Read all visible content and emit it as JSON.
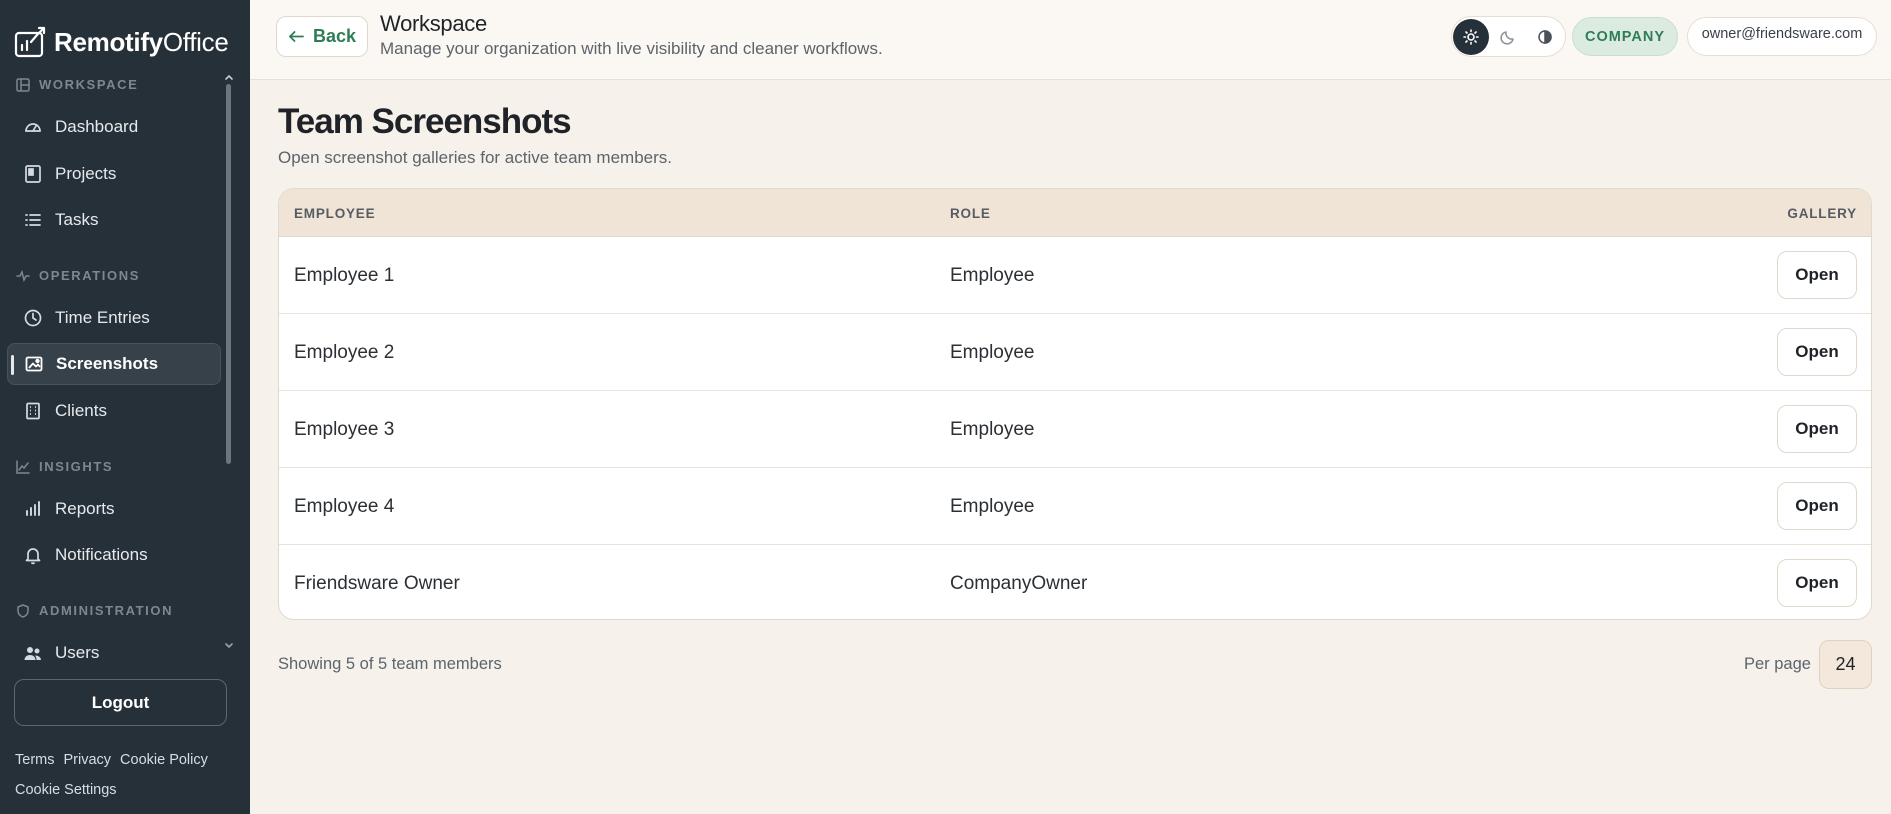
{
  "brand": {
    "name_bold": "Remotify",
    "name_light": "Office"
  },
  "sidebar": {
    "sections": [
      {
        "label": "WORKSPACE",
        "icon": "layout-icon"
      },
      {
        "label": "OPERATIONS",
        "icon": "activity-icon"
      },
      {
        "label": "INSIGHTS",
        "icon": "trend-icon"
      },
      {
        "label": "ADMINISTRATION",
        "icon": "shield-icon"
      }
    ],
    "items": [
      {
        "label": "Dashboard",
        "icon": "gauge-icon"
      },
      {
        "label": "Projects",
        "icon": "folder-icon"
      },
      {
        "label": "Tasks",
        "icon": "list-icon"
      },
      {
        "label": "Time Entries",
        "icon": "clock-icon"
      },
      {
        "label": "Screenshots",
        "icon": "image-icon",
        "active": true
      },
      {
        "label": "Clients",
        "icon": "building-icon"
      },
      {
        "label": "Reports",
        "icon": "bar-chart-icon"
      },
      {
        "label": "Notifications",
        "icon": "bell-icon"
      },
      {
        "label": "Users",
        "icon": "users-icon"
      }
    ],
    "logout_label": "Logout",
    "footer_links": [
      "Terms",
      "Privacy",
      "Cookie Policy",
      "Cookie Settings"
    ]
  },
  "header": {
    "back_label": "Back",
    "title": "Workspace",
    "subtitle": "Manage your organization with live visibility and cleaner workflows.",
    "theme_options": [
      "light",
      "dark",
      "contrast"
    ],
    "theme_selected": "light",
    "role_badge": "COMPANY",
    "user_email": "owner@friendsware.com"
  },
  "main": {
    "title": "Team Screenshots",
    "subtitle": "Open screenshot galleries for active team members.",
    "table": {
      "columns": [
        "EMPLOYEE",
        "ROLE",
        "GALLERY"
      ],
      "rows": [
        {
          "employee": "Employee 1",
          "role": "Employee",
          "action": "Open"
        },
        {
          "employee": "Employee 2",
          "role": "Employee",
          "action": "Open"
        },
        {
          "employee": "Employee 3",
          "role": "Employee",
          "action": "Open"
        },
        {
          "employee": "Employee 4",
          "role": "Employee",
          "action": "Open"
        },
        {
          "employee": "Friendsware Owner",
          "role": "CompanyOwner",
          "action": "Open"
        }
      ]
    },
    "showing_text": "Showing 5 of 5 team members",
    "per_page_label": "Per page",
    "per_page_value": "24"
  },
  "colors": {
    "accent": "#2e7d57",
    "sidebar_bg": "#263039",
    "page_bg": "#f6f1ea",
    "table_header_bg": "#f0e4d7"
  }
}
